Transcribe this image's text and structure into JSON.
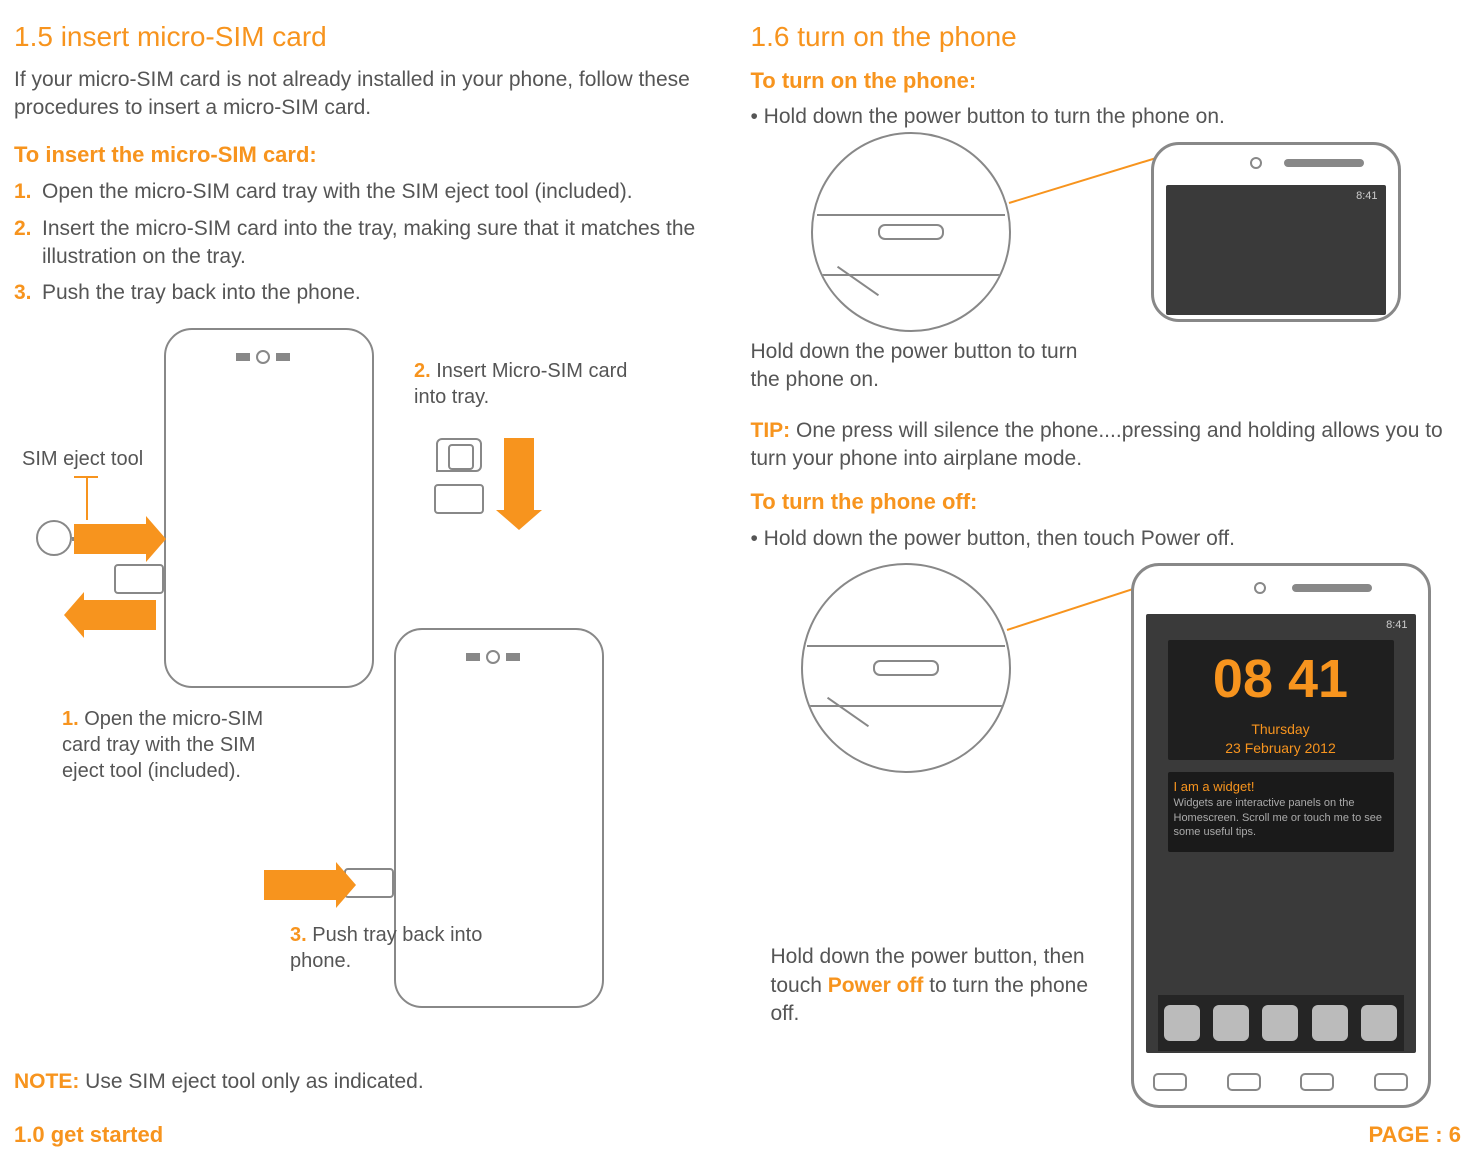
{
  "left": {
    "heading": "1.5 insert micro-SIM card",
    "intro": "If your micro-SIM card is not already installed in your phone, follow these procedures to insert a micro-SIM card.",
    "subhead": "To insert the micro-SIM card:",
    "steps": [
      "Open the micro-SIM card tray with the SIM eject tool (included).",
      "Insert the micro-SIM card into the tray, making sure that it matches the illustration on the tray.",
      "Push the tray back into the phone."
    ],
    "diagram": {
      "eject_label": "SIM eject tool",
      "c1_num": "1.",
      "c1_text": "Open the micro-SIM card tray with the SIM eject tool (included).",
      "c2_num": "2.",
      "c2_text": "Insert Micro-SIM card into tray.",
      "c3_num": "3.",
      "c3_text": "Push tray back into phone."
    },
    "note_label": "NOTE:",
    "note_text": "Use SIM eject tool only as indicated."
  },
  "right": {
    "heading": "1.6 turn on the phone",
    "sub_on": "To turn on the phone:",
    "bullet_on": "• Hold down the power button to turn the phone on.",
    "cap_on": "Hold down the power button to turn the phone on.",
    "tip_label": "TIP:",
    "tip_text": "One press will silence the phone....pressing and holding allows you to turn your phone into airplane mode.",
    "sub_off": "To turn the phone off:",
    "bullet_off": "• Hold down the power button, then touch Power off.",
    "cap_off_pre": "Hold down the power button, then touch ",
    "cap_off_orange": "Power off",
    "cap_off_post": " to turn the phone off.",
    "clock": {
      "time": "08  41",
      "date": "Thursday\n23 February 2012"
    },
    "widget": {
      "title": "I am a widget!",
      "body": "Widgets are interactive panels on the Homescreen. Scroll me or touch me to see some useful tips."
    },
    "status_time": "8:41"
  },
  "footer": {
    "left": "1.0 get started",
    "right": "PAGE : 6"
  }
}
